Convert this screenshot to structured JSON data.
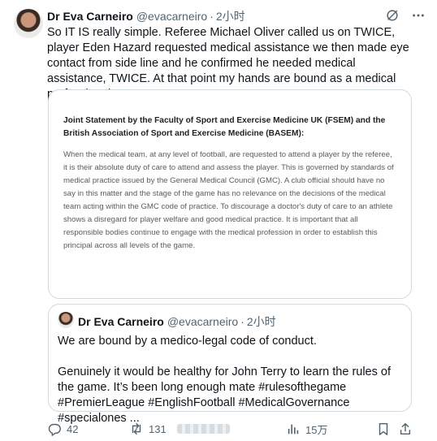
{
  "tweet": {
    "author_name": "Dr Eva Carneiro",
    "author_handle": "@evacarneiro",
    "separator": "·",
    "time": "2小时",
    "text": "So IT IS really simple. Referee Michael Oliver called us on TWICE, player Eden Hazard requested medical assistance we then made eye contact from side line and he confirmed he needed medical assistance, TWICE. At that point my hands are bound as a medical professional."
  },
  "statement": {
    "title": "Joint Statement by the Faculty of Sport and Exercise Medicine UK (FSEM) and the British Association of Sport and Exercise Medicine (BASEM):",
    "body": "When the medical team, at any level of football, are requested to attend a player by the referee, it is their absolute duty of care to attend and assess the player. This is governed by standards of medical practice issued by the General Medical Council (GMC). A club official should have no say in this matter and the stage of the game has no relevance on the decisions of the medical team acting within the GMC code of practice. To discourage a doctor's duty of care to an athlete shows a disregard for player welfare and good medical practice. It is important that all responsible bodies continue to engage with the medical profession in order to establish this principal across all levels of the game."
  },
  "quote": {
    "author_name": "Dr Eva Carneiro",
    "author_handle": "@evacarneiro",
    "separator": "·",
    "time": "2小时",
    "line1": "We are bound by a medico-legal code of conduct.",
    "line2": "Genuinely it would be healthy for John Terry to learn the rules of the game. It’s been long enough mate  #rulesofthegame #PremierLeague #EnglishFootball #MedicalGovernance #specialones ..."
  },
  "actions": {
    "replies": "42",
    "retweets": "131",
    "views": "15万"
  },
  "colors": {
    "text": "#0f1419",
    "muted": "#536471",
    "border": "#cfd9de"
  }
}
